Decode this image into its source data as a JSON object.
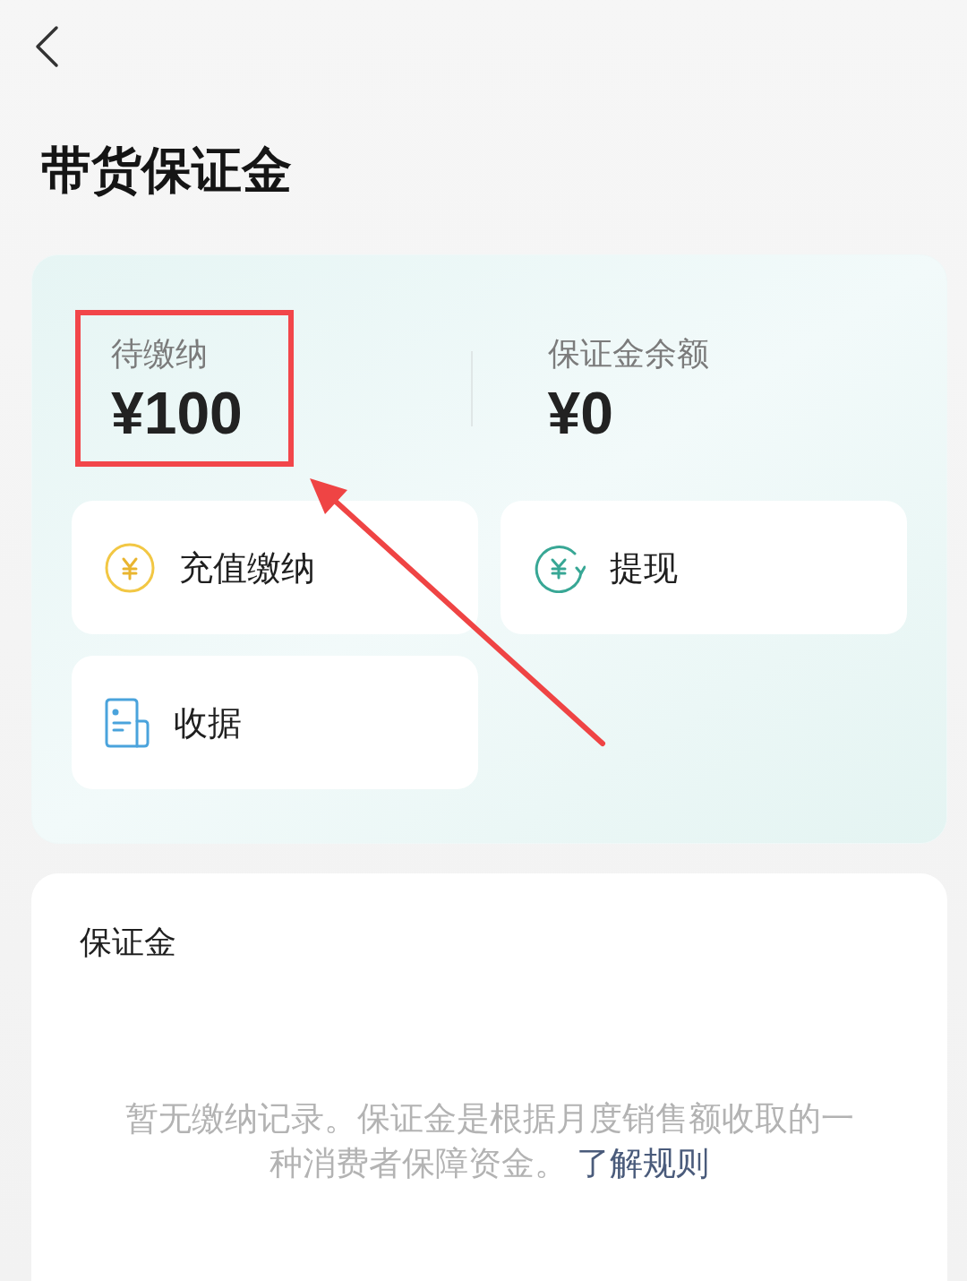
{
  "header": {
    "title": "带货保证金"
  },
  "summary": {
    "stats": [
      {
        "label": "待缴纳",
        "value": "¥100",
        "highlighted": true
      },
      {
        "label": "保证金余额",
        "value": "¥0",
        "highlighted": false
      }
    ],
    "actions": [
      {
        "kind": "coin",
        "label": "充值缴纳"
      },
      {
        "kind": "exchange",
        "label": "提现"
      },
      {
        "kind": "document",
        "label": "收据"
      }
    ]
  },
  "records": {
    "title": "保证金",
    "empty_message": "暂无缴纳记录。保证金是根据月度销售额收取的一种消费者保障资金。",
    "link": "了解规则"
  }
}
